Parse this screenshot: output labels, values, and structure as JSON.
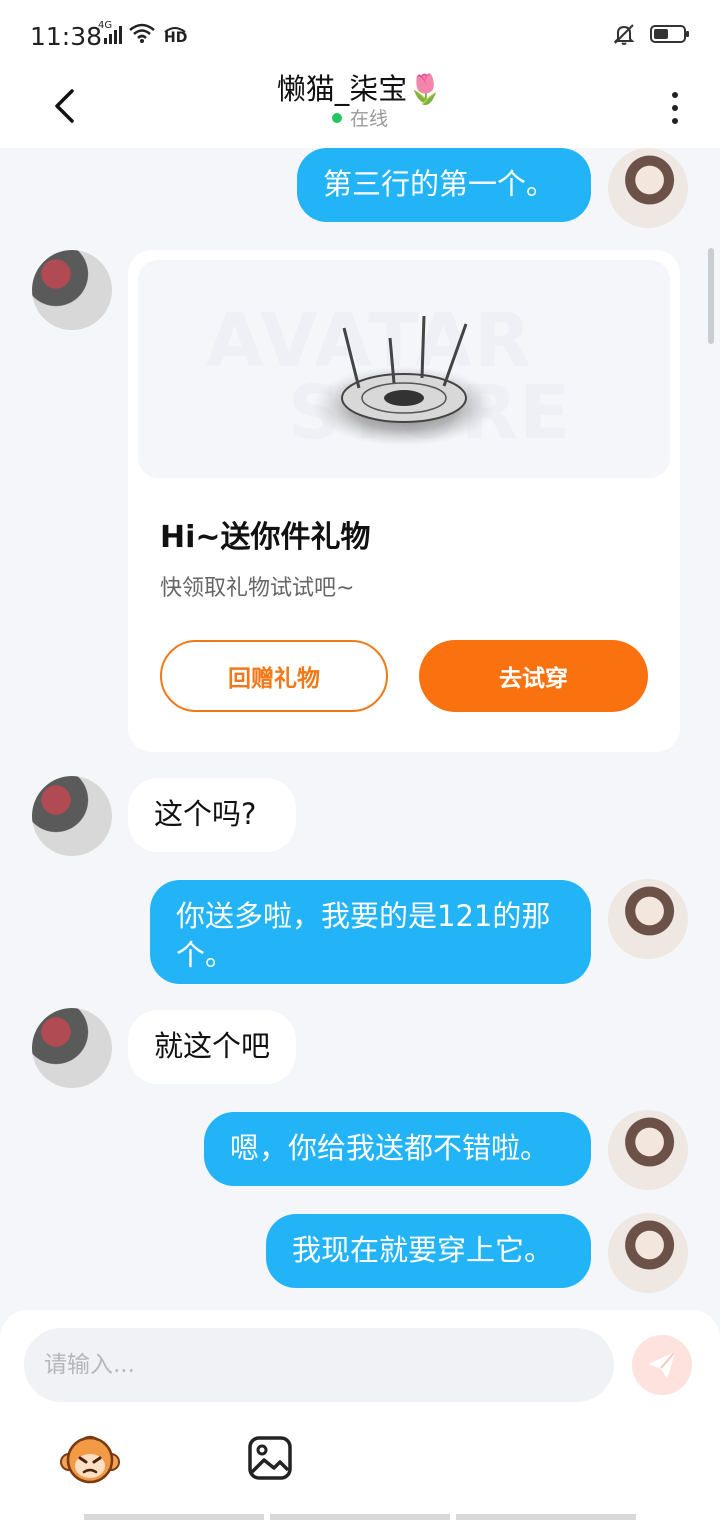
{
  "status_bar": {
    "time": "11:38",
    "network": "4G",
    "hd": "HD"
  },
  "header": {
    "title": "懒猫_柒宝🌷",
    "status": "在线"
  },
  "messages": [
    {
      "side": "self",
      "text": "第三行的第一个。"
    },
    {
      "side": "peer",
      "type": "gift_card"
    },
    {
      "side": "peer",
      "text": "这个吗?"
    },
    {
      "side": "self",
      "text": "你送多啦，我要的是121的那个。"
    },
    {
      "side": "peer",
      "text": "就这个吧"
    },
    {
      "side": "self",
      "text": "嗯，你给我送都不错啦。"
    },
    {
      "side": "self",
      "text": "我现在就要穿上它。"
    }
  ],
  "gift_card": {
    "watermark_top": "AVATAR",
    "watermark_bottom": "STORE",
    "title": "Hi~送你件礼物",
    "subtitle": "快领取礼物试试吧~",
    "return_button": "回赠礼物",
    "try_button": "去试穿"
  },
  "input": {
    "placeholder": "请输入..."
  },
  "colors": {
    "self_bubble": "#23b3f7",
    "accent_orange": "#f9720f",
    "online": "#22c55e",
    "background": "#f4f6f9"
  },
  "icons": {
    "back": "chevron-left-icon",
    "more": "more-vertical-icon",
    "send": "send-icon",
    "emoji": "emoji-monkey-icon",
    "image": "image-icon"
  }
}
